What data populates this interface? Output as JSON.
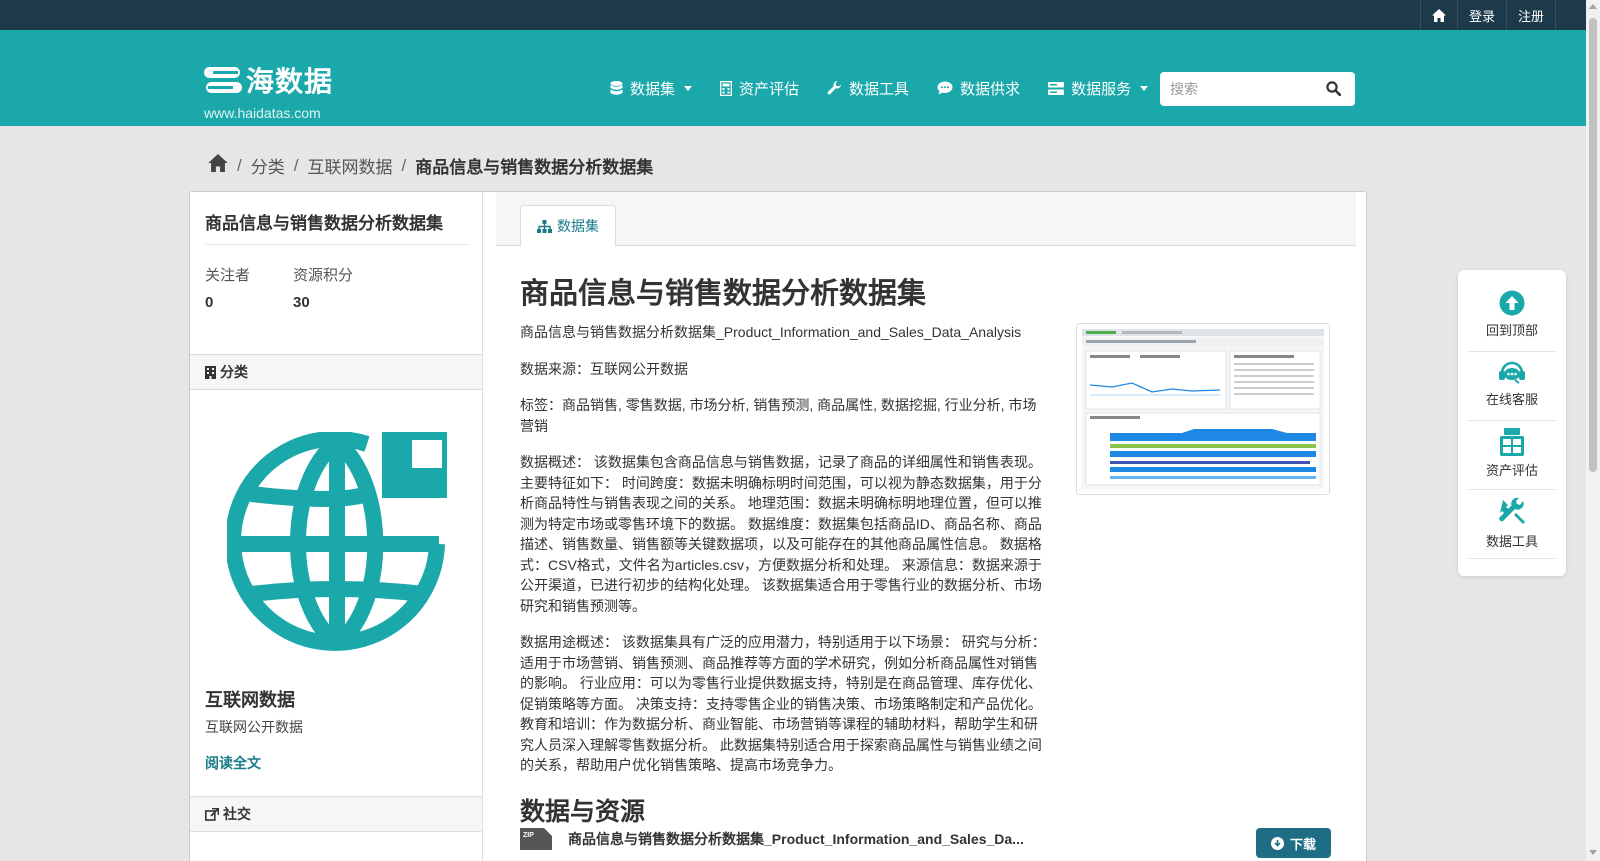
{
  "topbar": {
    "login": "登录",
    "register": "注册"
  },
  "brand": {
    "name": "海数据",
    "url": "www.haidatas.com"
  },
  "nav": {
    "items": [
      {
        "label": "数据集",
        "icon": "database-icon",
        "dropdown": true
      },
      {
        "label": "资产评估",
        "icon": "calculator-icon",
        "dropdown": false
      },
      {
        "label": "数据工具",
        "icon": "wrench-icon",
        "dropdown": false
      },
      {
        "label": "数据供求",
        "icon": "comment-icon",
        "dropdown": false
      },
      {
        "label": "数据服务",
        "icon": "server-icon",
        "dropdown": true
      }
    ]
  },
  "search": {
    "placeholder": "搜索"
  },
  "breadcrumb": {
    "items": [
      "分类",
      "互联网数据",
      "商品信息与销售数据分析数据集"
    ]
  },
  "sidebar": {
    "title": "商品信息与销售数据分析数据集",
    "followers_label": "关注者",
    "followers": "0",
    "points_label": "资源积分",
    "points": "30",
    "category_heading": "分类",
    "org_name": "互联网数据",
    "org_desc": "互联网公开数据",
    "read_more": "阅读全文",
    "social_heading": "社交"
  },
  "tab": {
    "label": "数据集"
  },
  "dataset": {
    "title": "商品信息与销售数据分析数据集",
    "paragraphs": [
      "商品信息与销售数据分析数据集_Product_Information_and_Sales_Data_Analysis",
      "数据来源：互联网公开数据",
      "标签：商品销售, 零售数据, 市场分析, 销售预测, 商品属性, 数据挖掘, 行业分析, 市场营销",
      "数据概述： 该数据集包含商品信息与销售数据，记录了商品的详细属性和销售表现。主要特征如下： 时间跨度：数据未明确标明时间范围，可以视为静态数据集，用于分析商品特性与销售表现之间的关系。 地理范围：数据未明确标明地理位置，但可以推测为特定市场或零售环境下的数据。 数据维度：数据集包括商品ID、商品名称、商品描述、销售数量、销售额等关键数据项，以及可能存在的其他商品属性信息。 数据格式：CSV格式，文件名为articles.csv，方便数据分析和处理。 来源信息：数据来源于公开渠道，已进行初步的结构化处理。 该数据集适合用于零售行业的数据分析、市场研究和销售预测等。",
      "数据用途概述： 该数据集具有广泛的应用潜力，特别适用于以下场景： 研究与分析：适用于市场营销、销售预测、商品推荐等方面的学术研究，例如分析商品属性对销售的影响。 行业应用：可以为零售行业提供数据支持，特别是在商品管理、库存优化、促销策略等方面。 决策支持：支持零售企业的销售决策、市场策略制定和产品优化。 教育和培训：作为数据分析、商业智能、市场营销等课程的辅助材料，帮助学生和研究人员深入理解零售数据分析。 此数据集特别适合用于探索商品属性与销售业绩之间的关系，帮助用户优化销售策略、提高市场竞争力。"
    ],
    "resources_heading": "数据与资源",
    "resource_name": "商品信息与销售数据分析数据集_Product_Information_and_Sales_Da...",
    "resource_format": "ZIP",
    "download_label": "下载"
  },
  "float_panel": {
    "items": [
      {
        "label": "回到顶部",
        "icon": "arrow-up-circle-icon"
      },
      {
        "label": "在线客服",
        "icon": "headset-icon"
      },
      {
        "label": "资产评估",
        "icon": "calculator-icon"
      },
      {
        "label": "数据工具",
        "icon": "tools-icon"
      }
    ]
  },
  "colors": {
    "topbar": "#1d3a4b",
    "masthead": "#1ba8ab",
    "accent": "#187b8a",
    "button": "#1d6e85"
  }
}
